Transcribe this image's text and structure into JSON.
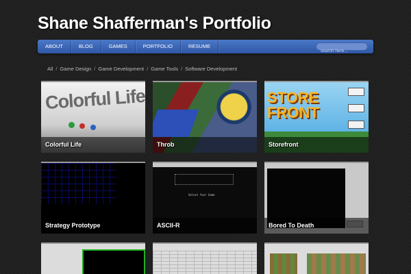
{
  "site": {
    "title": "Shane Shafferman's Portfolio"
  },
  "nav": {
    "items": [
      {
        "label": "About"
      },
      {
        "label": "Blog"
      },
      {
        "label": "Games"
      },
      {
        "label": "Portfolio"
      },
      {
        "label": "Resume"
      }
    ],
    "search_placeholder": "search here..."
  },
  "filters": {
    "items": [
      "All",
      "Game Design",
      "Game Development",
      "Game Tools",
      "Software Development"
    ],
    "separator": "/"
  },
  "portfolio": {
    "tiles": [
      {
        "title": "Colorful Life",
        "thumb_text": "Colorful Life"
      },
      {
        "title": "Throb"
      },
      {
        "title": "Storefront",
        "thumb_text": "STORE FRONT"
      },
      {
        "title": "Strategy Prototype"
      },
      {
        "title": "ASCII-R",
        "thumb_text": "Select Your Game"
      },
      {
        "title": "Bored To Death"
      },
      {
        "title": ""
      },
      {
        "title": ""
      },
      {
        "title": ""
      }
    ]
  },
  "colors": {
    "nav_blue": "#3a66b8",
    "background": "#222222",
    "caption_text": "#ffffff"
  }
}
